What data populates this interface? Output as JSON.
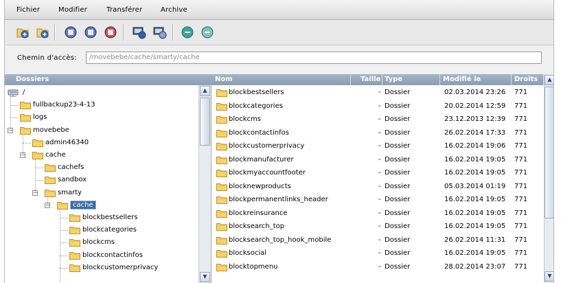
{
  "menu": [
    "Fichier",
    "Modifier",
    "Transférer",
    "Archive"
  ],
  "toolbar": {
    "buttons": [
      {
        "name": "new-folder-icon",
        "color": "#3b78c4"
      },
      {
        "name": "refresh-folder-icon",
        "color": "#3b78c4"
      },
      {
        "name": "copy-icon",
        "color": "#5a78c8"
      },
      {
        "name": "move-icon",
        "color": "#5a78c8"
      },
      {
        "name": "delete-icon",
        "color": "#d94848"
      },
      {
        "name": "upload-icon",
        "color": "#2f63b0"
      },
      {
        "name": "download-icon",
        "color": "#8aa4cc"
      },
      {
        "name": "compress-icon",
        "color": "#3aa59a"
      },
      {
        "name": "extract-icon",
        "color": "#7fc2b8"
      }
    ]
  },
  "path": {
    "label": "Chemin d'accès:",
    "value": "/movebebe/cache/smarty/cache"
  },
  "tree": {
    "header": "Dossiers",
    "root": "/",
    "items": [
      {
        "label": "fullbackup23-4-13",
        "depth": 1
      },
      {
        "label": "logs",
        "depth": 1
      },
      {
        "label": "movebebe",
        "depth": 1,
        "expanded": true
      },
      {
        "label": "admin46340",
        "depth": 2
      },
      {
        "label": "cache",
        "depth": 2,
        "expanded": true
      },
      {
        "label": "cachefs",
        "depth": 3
      },
      {
        "label": "sandbox",
        "depth": 3
      },
      {
        "label": "smarty",
        "depth": 3,
        "expanded": true
      },
      {
        "label": "cache",
        "depth": 4,
        "expanded": true,
        "selected": true
      },
      {
        "label": "blockbestsellers",
        "depth": 5
      },
      {
        "label": "blockcategories",
        "depth": 5
      },
      {
        "label": "blockcms",
        "depth": 5
      },
      {
        "label": "blockcontactinfos",
        "depth": 5
      },
      {
        "label": "blockcustomerprivacy",
        "depth": 5
      }
    ]
  },
  "list": {
    "columns": [
      "Nom",
      "Taille",
      "Type",
      "Modifié le",
      "Droits"
    ],
    "rows": [
      {
        "name": "blockbestsellers",
        "size": "-",
        "type": "Dossier",
        "modified": "02.03.2014 23:26",
        "rights": "771"
      },
      {
        "name": "blockcategories",
        "size": "-",
        "type": "Dossier",
        "modified": "20.02.2014 12:59",
        "rights": "771"
      },
      {
        "name": "blockcms",
        "size": "-",
        "type": "Dossier",
        "modified": "23.12.2013 12:39",
        "rights": "771"
      },
      {
        "name": "blockcontactinfos",
        "size": "-",
        "type": "Dossier",
        "modified": "26.02.2014 17:33",
        "rights": "771"
      },
      {
        "name": "blockcustomerprivacy",
        "size": "-",
        "type": "Dossier",
        "modified": "16.02.2014 19:06",
        "rights": "771"
      },
      {
        "name": "blockmanufacturer",
        "size": "-",
        "type": "Dossier",
        "modified": "16.02.2014 19:05",
        "rights": "771"
      },
      {
        "name": "blockmyaccountfooter",
        "size": "-",
        "type": "Dossier",
        "modified": "16.02.2014 19:05",
        "rights": "771"
      },
      {
        "name": "blocknewproducts",
        "size": "-",
        "type": "Dossier",
        "modified": "05.03.2014 01:19",
        "rights": "771"
      },
      {
        "name": "blockpermanentlinks_header",
        "size": "-",
        "type": "Dossier",
        "modified": "16.02.2014 19:05",
        "rights": "771"
      },
      {
        "name": "blockreinsurance",
        "size": "-",
        "type": "Dossier",
        "modified": "16.02.2014 19:05",
        "rights": "771"
      },
      {
        "name": "blocksearch_top",
        "size": "-",
        "type": "Dossier",
        "modified": "16.02.2014 19:05",
        "rights": "771"
      },
      {
        "name": "blocksearch_top_hook_mobile",
        "size": "-",
        "type": "Dossier",
        "modified": "26.02.2014 11:31",
        "rights": "771"
      },
      {
        "name": "blocksocial",
        "size": "-",
        "type": "Dossier",
        "modified": "16.02.2014 19:05",
        "rights": "771"
      },
      {
        "name": "blocktopmenu",
        "size": "-",
        "type": "Dossier",
        "modified": "28.02.2014 23:07",
        "rights": "771"
      }
    ]
  }
}
